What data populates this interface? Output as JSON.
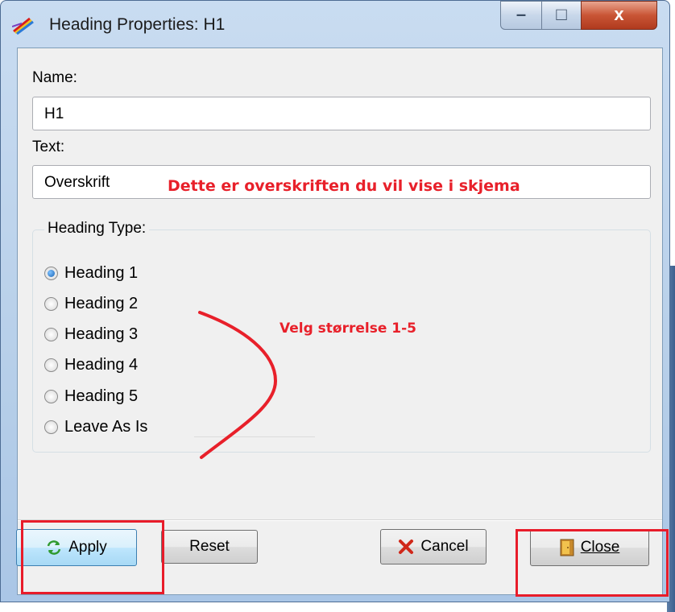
{
  "window": {
    "title": "Heading Properties: H1",
    "controls": {
      "minimize": "–",
      "maximize": "□",
      "close": "x"
    }
  },
  "form": {
    "name_label": "Name:",
    "name_value": "H1",
    "text_label": "Text:",
    "text_value": "Overskrift"
  },
  "heading_type": {
    "title": "Heading Type:",
    "options": [
      {
        "label": "Heading 1",
        "checked": true
      },
      {
        "label": "Heading 2",
        "checked": false
      },
      {
        "label": "Heading 3",
        "checked": false
      },
      {
        "label": "Heading 4",
        "checked": false
      },
      {
        "label": "Heading 5",
        "checked": false
      },
      {
        "label": "Leave As Is",
        "checked": false
      }
    ]
  },
  "buttons": {
    "apply": "Apply",
    "reset": "Reset",
    "cancel": "Cancel",
    "close": "Close"
  },
  "annotations": {
    "text_note": "Dette er overskriften du vil vise i skjema",
    "size_note": "Velg størrelse 1-5",
    "color": "#e8202a"
  },
  "icons": {
    "app": "pencil-rainbow-icon",
    "apply": "refresh-arrows-icon",
    "cancel": "red-x-icon",
    "close": "door-icon"
  }
}
